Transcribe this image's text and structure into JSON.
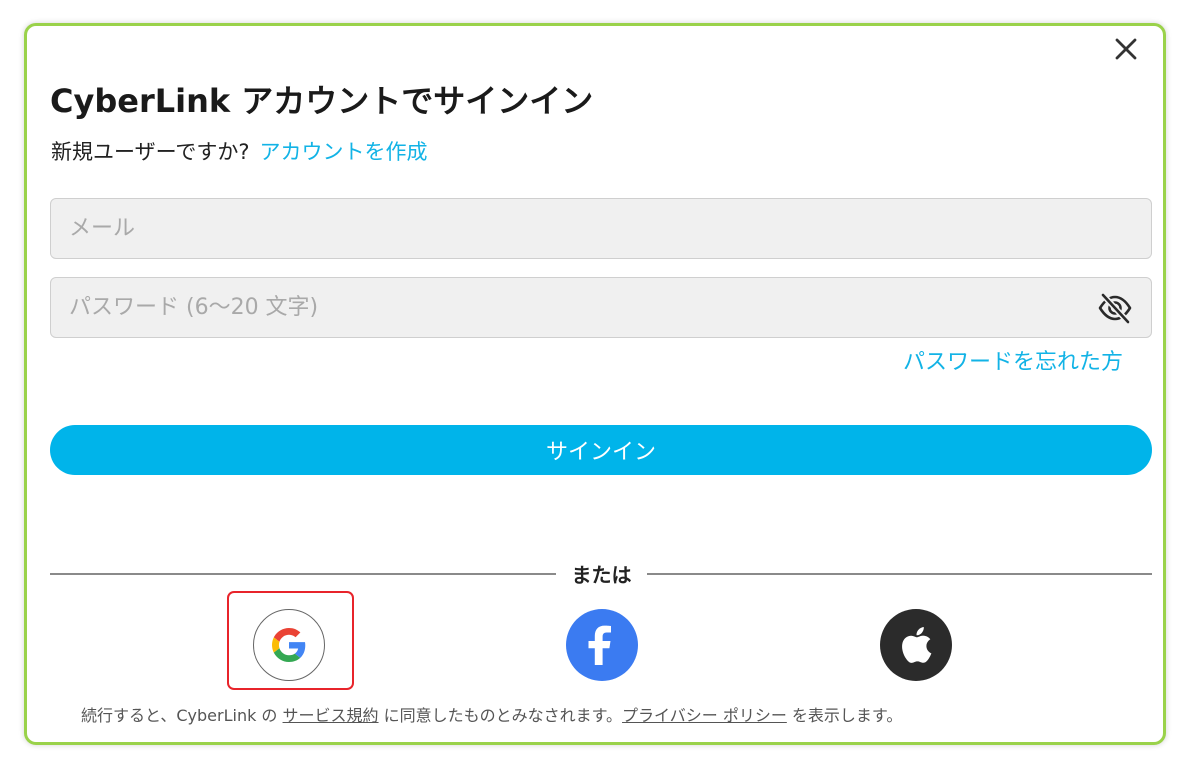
{
  "dialog": {
    "title": "CyberLink アカウントでサインイン",
    "close_icon": "close-icon"
  },
  "signup": {
    "prompt": "新規ユーザーですか?",
    "link": "アカウントを作成"
  },
  "email": {
    "placeholder": "メール",
    "value": ""
  },
  "password": {
    "placeholder": "パスワード (6〜20 文字)",
    "value": "",
    "toggle_icon": "eye-slash-icon"
  },
  "forgot_link": "パスワードを忘れた方",
  "signin_button": "サインイン",
  "divider_text": "または",
  "social": {
    "google_icon": "google-icon",
    "facebook_icon": "facebook-icon",
    "apple_icon": "apple-icon"
  },
  "terms": {
    "prefix": "続行すると、CyberLink の",
    "tos_link": "サービス規約",
    "middle": "に同意したものとみなされます。",
    "privacy_link": "プライバシー ポリシー",
    "suffix": "を表示します。"
  },
  "colors": {
    "accent": "#00b4ea",
    "link": "#12b3e6",
    "dialog_border": "#9ad24a",
    "highlight": "#e8242b",
    "facebook": "#3b7bf1",
    "apple": "#2b2b2b"
  }
}
